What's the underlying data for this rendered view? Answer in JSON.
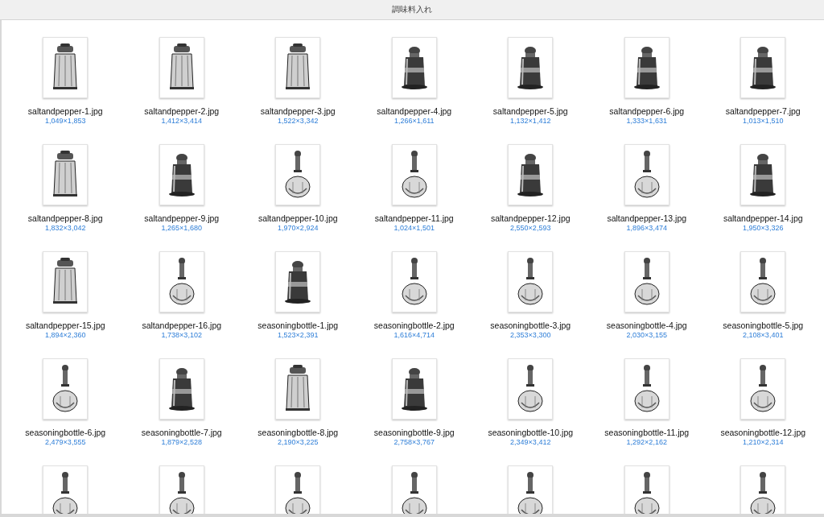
{
  "window": {
    "title": "調味料入れ"
  },
  "files": [
    {
      "kind": "shaker",
      "name": "saltandpepper-1.jpg",
      "dimensions": "1,049×1,853"
    },
    {
      "kind": "shaker",
      "name": "saltandpepper-2.jpg",
      "dimensions": "1,412×3,414"
    },
    {
      "kind": "shaker",
      "name": "saltandpepper-3.jpg",
      "dimensions": "1,522×3,342"
    },
    {
      "kind": "mill",
      "name": "saltandpepper-4.jpg",
      "dimensions": "1,266×1,611"
    },
    {
      "kind": "mill",
      "name": "saltandpepper-5.jpg",
      "dimensions": "1,132×1,412"
    },
    {
      "kind": "mill",
      "name": "saltandpepper-6.jpg",
      "dimensions": "1,333×1,631"
    },
    {
      "kind": "mill",
      "name": "saltandpepper-7.jpg",
      "dimensions": "1,013×1,510"
    },
    {
      "kind": "shaker",
      "name": "saltandpepper-8.jpg",
      "dimensions": "1,832×3,042"
    },
    {
      "kind": "mill",
      "name": "saltandpepper-9.jpg",
      "dimensions": "1,265×1,680"
    },
    {
      "kind": "decanter",
      "name": "saltandpepper-10.jpg",
      "dimensions": "1,970×2,924"
    },
    {
      "kind": "decanter",
      "name": "saltandpepper-11.jpg",
      "dimensions": "1,024×1,501"
    },
    {
      "kind": "mill",
      "name": "saltandpepper-12.jpg",
      "dimensions": "2,550×2,593"
    },
    {
      "kind": "decanter",
      "name": "saltandpepper-13.jpg",
      "dimensions": "1,896×3,474"
    },
    {
      "kind": "mill",
      "name": "saltandpepper-14.jpg",
      "dimensions": "1,950×3,326"
    },
    {
      "kind": "shaker",
      "name": "saltandpepper-15.jpg",
      "dimensions": "1,894×2,360"
    },
    {
      "kind": "decanter",
      "name": "saltandpepper-16.jpg",
      "dimensions": "1,738×3,102"
    },
    {
      "kind": "mill",
      "name": "seasoningbottle-1.jpg",
      "dimensions": "1,523×2,391"
    },
    {
      "kind": "decanter",
      "name": "seasoningbottle-2.jpg",
      "dimensions": "1,616×4,714"
    },
    {
      "kind": "decanter",
      "name": "seasoningbottle-3.jpg",
      "dimensions": "2,353×3,300"
    },
    {
      "kind": "decanter",
      "name": "seasoningbottle-4.jpg",
      "dimensions": "2,030×3,155"
    },
    {
      "kind": "decanter",
      "name": "seasoningbottle-5.jpg",
      "dimensions": "2,108×3,401"
    },
    {
      "kind": "decanter",
      "name": "seasoningbottle-6.jpg",
      "dimensions": "2,479×3,555"
    },
    {
      "kind": "mill",
      "name": "seasoningbottle-7.jpg",
      "dimensions": "1,879×2,528"
    },
    {
      "kind": "shaker",
      "name": "seasoningbottle-8.jpg",
      "dimensions": "2,190×3,225"
    },
    {
      "kind": "mill",
      "name": "seasoningbottle-9.jpg",
      "dimensions": "2,758×3,767"
    },
    {
      "kind": "decanter",
      "name": "seasoningbottle-10.jpg",
      "dimensions": "2,349×3,412"
    },
    {
      "kind": "decanter",
      "name": "seasoningbottle-11.jpg",
      "dimensions": "1,292×2,162"
    },
    {
      "kind": "decanter",
      "name": "seasoningbottle-12.jpg",
      "dimensions": "1,210×2,314"
    },
    {
      "kind": "decanter"
    },
    {
      "kind": "decanter"
    },
    {
      "kind": "decanter"
    },
    {
      "kind": "decanter"
    },
    {
      "kind": "decanter"
    },
    {
      "kind": "decanter"
    },
    {
      "kind": "decanter"
    }
  ]
}
